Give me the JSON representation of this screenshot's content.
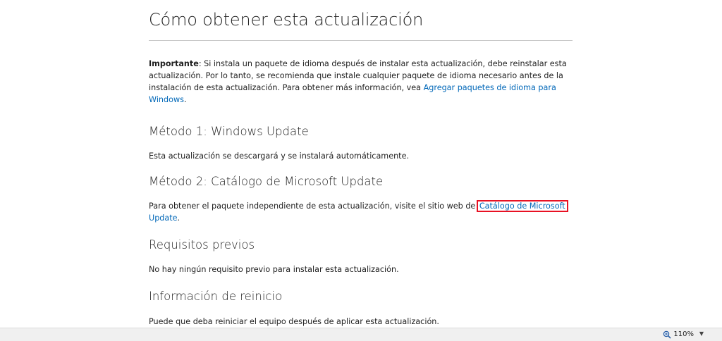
{
  "title": "Cómo obtener esta actualización",
  "important": {
    "label": "Importante",
    "text": ": Si instala un paquete de idioma después de instalar esta actualización, debe reinstalar esta actualización. Por lo tanto, se recomienda que instale cualquier paquete de idioma necesario antes de la instalación de esta actualización. Para obtener más información, vea ",
    "link": "Agregar paquetes de idioma para Windows",
    "after": "."
  },
  "method1": {
    "heading": "Método 1: Windows Update",
    "text": "Esta actualización se descargará y se instalará automáticamente."
  },
  "method2": {
    "heading": "Método 2: Catálogo de Microsoft Update",
    "text": "Para obtener el paquete independiente de esta actualización, visite el sitio web de ",
    "link_part1": "Catálogo de Microsoft",
    "link_part2": "Update",
    "after": "."
  },
  "prerequisites": {
    "heading": "Requisitos previos",
    "text": "No hay ningún requisito previo para instalar esta actualización."
  },
  "restart": {
    "heading": "Información de reinicio",
    "text": "Puede que deba reiniciar el equipo después de aplicar esta actualización."
  },
  "statusbar": {
    "zoom_label": "110%",
    "zoom_icon": "zoom-magnifier-icon",
    "dropdown_icon": "chevron-down-icon"
  },
  "colors": {
    "link": "#0067b8",
    "highlight": "#e81123"
  }
}
